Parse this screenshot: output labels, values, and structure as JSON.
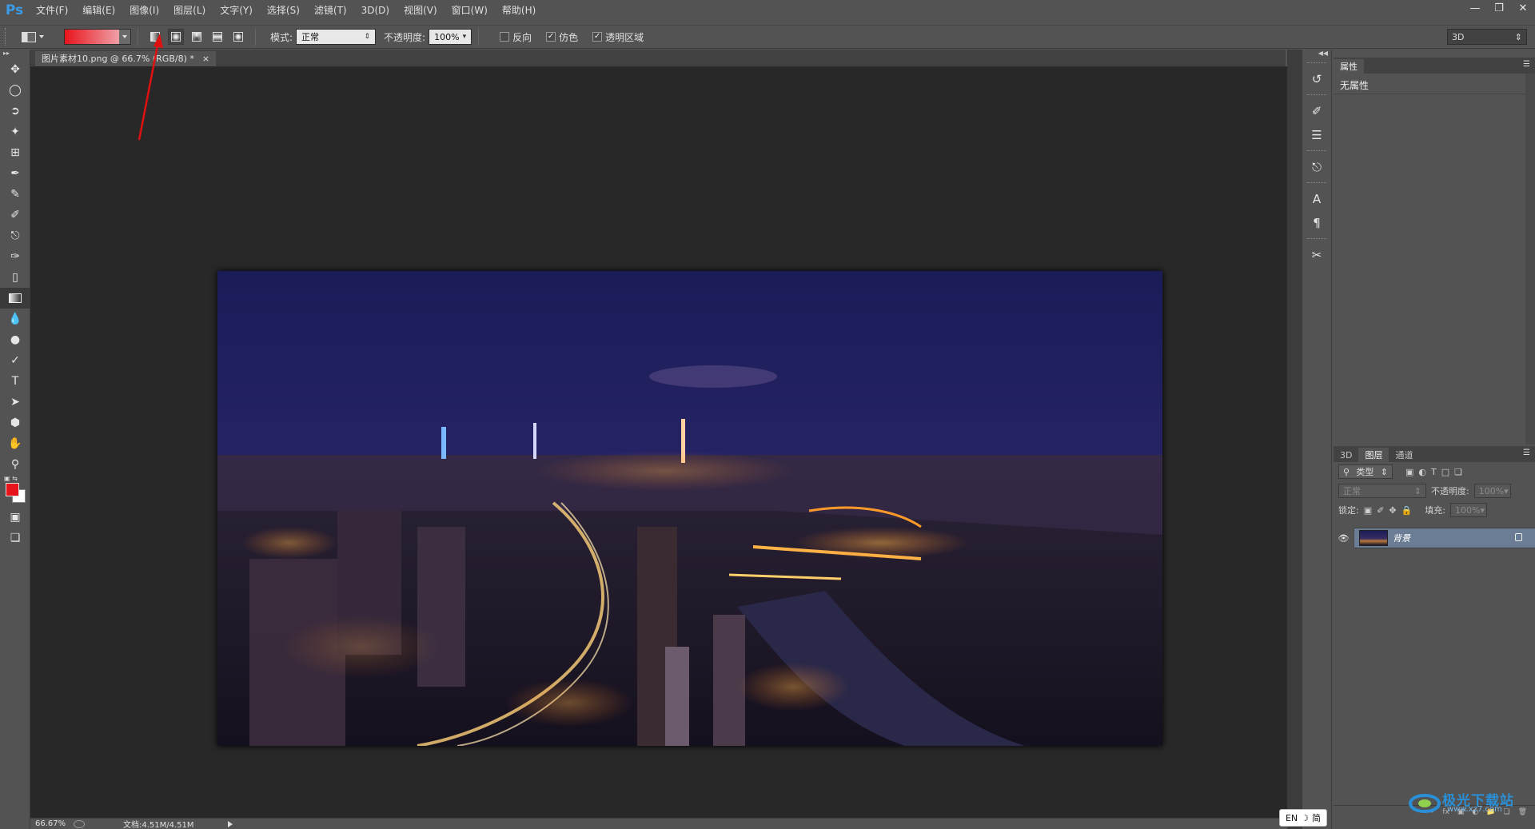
{
  "app": {
    "logo": "Ps",
    "menus": [
      "文件(F)",
      "编辑(E)",
      "图像(I)",
      "图层(L)",
      "文字(Y)",
      "选择(S)",
      "滤镜(T)",
      "3D(D)",
      "视图(V)",
      "窗口(W)",
      "帮助(H)"
    ],
    "window_controls": [
      "minimize-icon",
      "restore-icon",
      "close-icon"
    ]
  },
  "options": {
    "mode_label": "模式:",
    "mode_value": "正常",
    "opacity_label": "不透明度:",
    "opacity_value": "100%",
    "reverse_label": "反向",
    "reverse_checked": false,
    "dither_label": "仿色",
    "dither_checked": true,
    "transparency_label": "透明区域",
    "transparency_checked": true,
    "workspace_value": "3D",
    "gradient_colors": [
      "#e8141c",
      "#f0a0a8"
    ],
    "gradient_types": [
      "linear-gradient-icon",
      "radial-gradient-icon",
      "angle-gradient-icon",
      "reflected-gradient-icon",
      "diamond-gradient-icon"
    ],
    "selected_gradient_type": 1
  },
  "document": {
    "tab_title": "图片素材10.png @ 66.7% (RGB/8) *",
    "close": "×"
  },
  "status": {
    "zoom": "66.67%",
    "doc_info": "文档:4.51M/4.51M"
  },
  "tools": [
    "move-tool-icon",
    "marquee-tool-icon",
    "lasso-tool-icon",
    "magic-wand-icon",
    "crop-tool-icon",
    "eyedropper-icon",
    "healing-brush-icon",
    "brush-tool-icon",
    "clone-stamp-icon",
    "history-brush-icon",
    "eraser-icon",
    "gradient-tool-icon",
    "blur-tool-icon",
    "dodge-tool-icon",
    "pen-tool-icon",
    "type-tool-icon",
    "path-selection-icon",
    "shape-tool-icon",
    "hand-tool-icon",
    "zoom-tool-icon"
  ],
  "colors": {
    "foreground": "#e8141c",
    "background": "#ffffff"
  },
  "properties_panel": {
    "tab": "属性",
    "content": "无属性"
  },
  "layers_panel": {
    "tabs": [
      "3D",
      "图层",
      "通道"
    ],
    "active_tab": "图层",
    "filter_label": "类型",
    "blend_mode": "正常",
    "opacity_label": "不透明度:",
    "opacity_value": "100%",
    "lock_label": "锁定:",
    "fill_label": "填充:",
    "fill_value": "100%",
    "layer_name": "背景"
  },
  "ime": {
    "lang": "EN",
    "mode": "简"
  },
  "watermark": {
    "text": "极光下载站",
    "sub": "www.xz7.com"
  }
}
